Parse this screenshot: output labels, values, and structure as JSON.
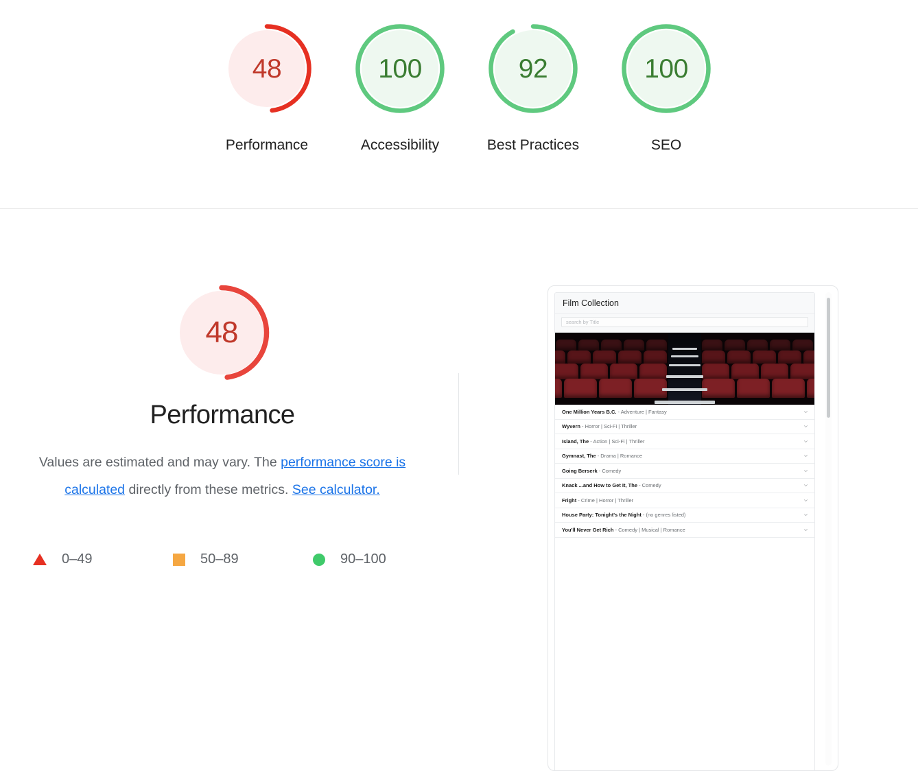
{
  "report": {
    "categories": [
      {
        "label": "Performance",
        "score": "48",
        "value": 48,
        "status": "fail"
      },
      {
        "label": "Accessibility",
        "score": "100",
        "value": 100,
        "status": "pass"
      },
      {
        "label": "Best Practices",
        "score": "92",
        "value": 92,
        "status": "pass"
      },
      {
        "label": "SEO",
        "score": "100",
        "value": 100,
        "status": "pass"
      }
    ]
  },
  "performance_section": {
    "gauge_score": "48",
    "gauge_value": 48,
    "title": "Performance",
    "description": {
      "lead": "Values are estimated and may vary. The ",
      "link1": "performance score is calculated",
      "middle": " directly from these metrics. ",
      "link2": "See calculator."
    },
    "legend": [
      {
        "icon": "triangle-fail-icon",
        "range": "0–49",
        "color": "#e63022"
      },
      {
        "icon": "square-average-icon",
        "range": "50–89",
        "color": "#f5a742"
      },
      {
        "icon": "circle-pass-icon",
        "range": "90–100",
        "color": "#3fca6a"
      }
    ]
  },
  "screenshot_panel": {
    "app_title": "Film Collection",
    "search_placeholder": "search by Title",
    "hero_image_alt": "cinema-seats-image",
    "films": [
      {
        "title": "One Million Years B.C.",
        "genres": " - Adventure | Fantasy"
      },
      {
        "title": "Wyvern",
        "genres": " - Horror | Sci-Fi | Thriller"
      },
      {
        "title": "Island, The",
        "genres": " - Action | Sci-Fi | Thriller"
      },
      {
        "title": "Gymnast, The",
        "genres": " - Drama | Romance"
      },
      {
        "title": "Going Berserk",
        "genres": " - Comedy"
      },
      {
        "title": "Knack ...and How to Get It, The",
        "genres": " - Comedy"
      },
      {
        "title": "Fright",
        "genres": " - Crime | Horror | Thriller"
      },
      {
        "title": "House Party: Tonight's the Night",
        "genres": " - (no genres listed)"
      },
      {
        "title": "You'll Never Get Rich",
        "genres": " - Comedy | Musical | Romance"
      }
    ]
  },
  "colors": {
    "fail": "#e63022",
    "fail_fill": "#fdecec",
    "fail_text": "#c0392b",
    "pass": "#5fc97f",
    "pass_fill": "#eef8f0",
    "pass_text": "#3a7d32",
    "average": "#f5a742",
    "link": "#1a73e8",
    "divider": "#e0e0e0"
  }
}
